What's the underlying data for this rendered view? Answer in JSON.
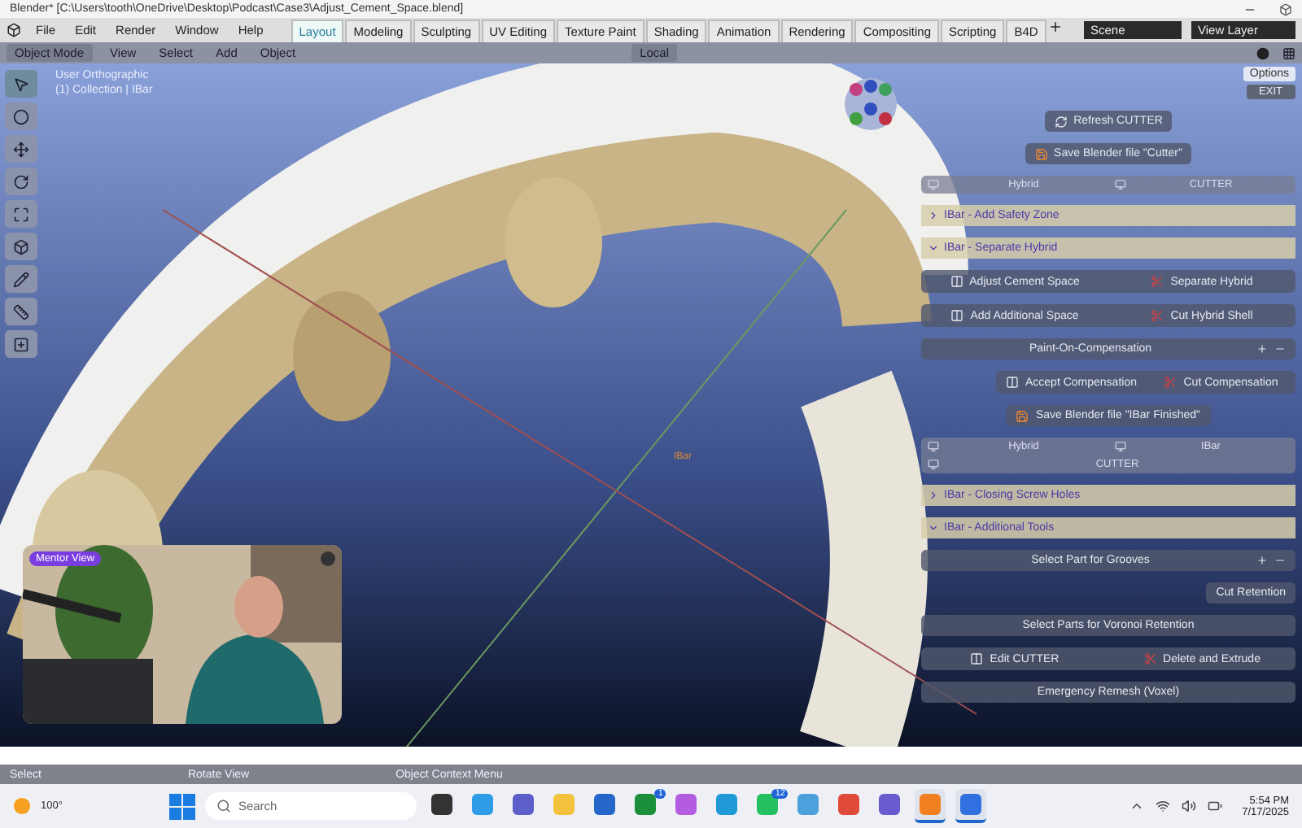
{
  "window": {
    "title": "Blender* [C:\\Users\\tooth\\OneDrive\\Desktop\\Podcast\\Case3\\Adjust_Cement_Space.blend]"
  },
  "menu": [
    "File",
    "Edit",
    "Render",
    "Window",
    "Help"
  ],
  "workspaces": [
    {
      "label": "Layout",
      "selected": true
    },
    {
      "label": "Modeling",
      "selected": false
    },
    {
      "label": "Sculpting",
      "selected": false
    },
    {
      "label": "UV Editing",
      "selected": false
    },
    {
      "label": "Texture Paint",
      "selected": false
    },
    {
      "label": "Shading",
      "selected": false
    },
    {
      "label": "Animation",
      "selected": false
    },
    {
      "label": "Rendering",
      "selected": false
    },
    {
      "label": "Compositing",
      "selected": false
    },
    {
      "label": "Scripting",
      "selected": false
    },
    {
      "label": "B4D",
      "selected": false
    }
  ],
  "scene": "Scene",
  "view_layer": "View Layer",
  "header": {
    "mode": "Object Mode",
    "menus": [
      "View",
      "Select",
      "Add",
      "Object"
    ],
    "orientation": "Local"
  },
  "viewport": {
    "view_name": "User Orthographic",
    "collection": "(1) Collection | IBar",
    "object_label": "IBar"
  },
  "panel": {
    "tab": "Options",
    "exit": "EXIT",
    "rows": [
      {
        "kind": "refresh_button",
        "label": "Refresh CUTTER"
      },
      {
        "kind": "save_button",
        "label": "Save Blender file \"Cutter\""
      },
      {
        "kind": "toggles",
        "items": [
          "Hybrid",
          "CUTTER"
        ]
      },
      {
        "kind": "section",
        "label": "IBar - Add Safety Zone",
        "expanded": false
      },
      {
        "kind": "section",
        "label": "IBar - Separate Hybrid",
        "expanded": true
      },
      {
        "kind": "pair",
        "items": [
          "Adjust Cement Space",
          "Separate Hybrid"
        ]
      },
      {
        "kind": "pair",
        "items": [
          "Add Additional Space",
          "Cut Hybrid Shell"
        ]
      },
      {
        "kind": "list",
        "label": "Paint-On-Compensation"
      },
      {
        "kind": "pair_right",
        "items": [
          "Accept Compensation",
          "Cut Compensation"
        ]
      },
      {
        "kind": "save_button",
        "label": "Save Blender file \"IBar Finished\""
      },
      {
        "kind": "toggles",
        "items": [
          "Hybrid",
          "IBar",
          "CUTTER"
        ]
      },
      {
        "kind": "section",
        "label": "IBar - Closing Screw Holes",
        "expanded": false
      },
      {
        "kind": "section",
        "label": "IBar - Additional Tools",
        "expanded": true
      },
      {
        "kind": "list",
        "label": "Select Part for Grooves"
      },
      {
        "kind": "button_right",
        "label": "Cut Retention"
      },
      {
        "kind": "wide",
        "label": "Select Parts for Voronoi Retention"
      },
      {
        "kind": "pair",
        "items": [
          "Edit CUTTER",
          "Delete and Extrude"
        ]
      },
      {
        "kind": "wide",
        "label": "Emergency Remesh (Voxel)"
      }
    ]
  },
  "webcam": {
    "badge": "Mentor View"
  },
  "status_bar": [
    "Select",
    "Rotate View",
    "Object Context Menu"
  ],
  "taskbar": {
    "weather": "100°",
    "search_placeholder": "Search",
    "apps": [
      {
        "kind": "files"
      },
      {
        "kind": "copilot"
      },
      {
        "kind": "teams"
      },
      {
        "kind": "folder"
      },
      {
        "kind": "store"
      },
      {
        "kind": "xbox",
        "badge": "1"
      },
      {
        "kind": "photos"
      },
      {
        "kind": "edge"
      },
      {
        "kind": "whatsapp",
        "badge": "12"
      },
      {
        "kind": "notepad"
      },
      {
        "kind": "chrome"
      },
      {
        "kind": "app"
      },
      {
        "kind": "blender",
        "active": true
      },
      {
        "kind": "recorder",
        "active": true
      }
    ],
    "time": "5:54 PM",
    "date": "7/17/2025"
  }
}
